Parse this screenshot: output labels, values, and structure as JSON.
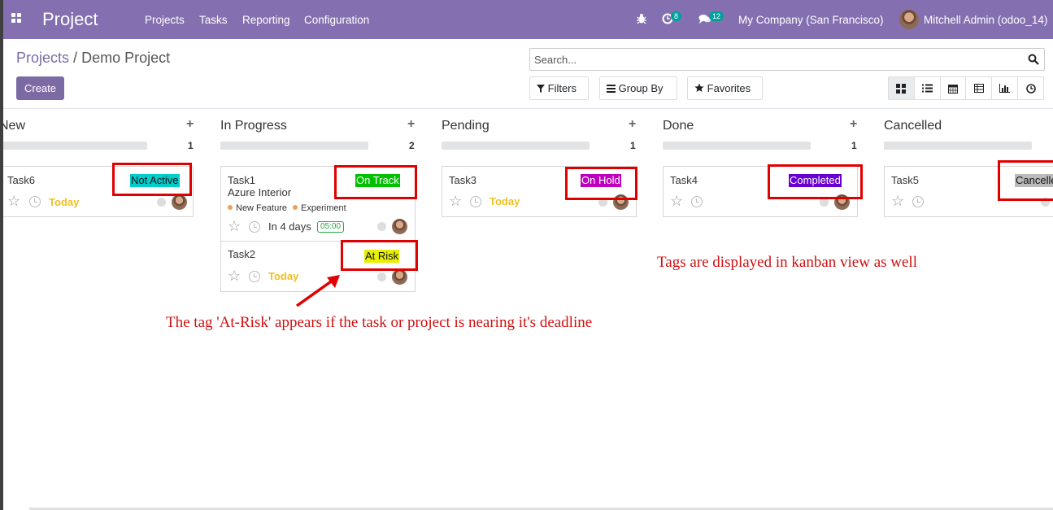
{
  "navbar": {
    "app_name": "Project",
    "menu": [
      "Projects",
      "Tasks",
      "Reporting",
      "Configuration"
    ],
    "activity_count": "8",
    "message_count": "12",
    "company": "My Company (San Francisco)",
    "user": "Mitchell Admin (odoo_14)",
    "bg_color": "#8470b0"
  },
  "control_panel": {
    "breadcrumb_parent": "Projects",
    "breadcrumb_sep": "/",
    "breadcrumb_current": "Demo Project",
    "create_label": "Create",
    "search_placeholder": "Search...",
    "filters_label": "Filters",
    "groupby_label": "Group By",
    "favorites_label": "Favorites",
    "views": [
      "kanban-icon",
      "list-icon",
      "calendar-icon",
      "pivot-icon",
      "graph-icon",
      "activity-icon"
    ]
  },
  "columns": [
    {
      "title": "New",
      "count": "1"
    },
    {
      "title": "In Progress",
      "count": "2"
    },
    {
      "title": "Pending",
      "count": "1"
    },
    {
      "title": "Done",
      "count": "1"
    },
    {
      "title": "Cancelled",
      "count": ""
    }
  ],
  "cards": {
    "task6": {
      "name": "Task6",
      "date": "Today",
      "tag": "Not Active",
      "tag_color": "#00cccc"
    },
    "task1": {
      "name": "Task1",
      "project": "Azure Interior",
      "tags": [
        "New Feature",
        "Experiment"
      ],
      "date": "In 4 days",
      "hours": "05:00",
      "tag": "On Track",
      "tag_color": "#00c000"
    },
    "task2": {
      "name": "Task2",
      "date": "Today",
      "tag": "At Risk",
      "tag_color": "#e6f000"
    },
    "task3": {
      "name": "Task3",
      "date": "Today",
      "tag": "On Hold",
      "tag_color": "#c000c0"
    },
    "task4": {
      "name": "Task4",
      "tag": "Completed",
      "tag_color": "#6a00d0"
    },
    "task5": {
      "name": "Task5",
      "tag": "Cancelled",
      "tag_color": "#bbbbbb"
    }
  },
  "annotations": {
    "at_risk_note": "The tag 'At-Risk' appears if the task or project is nearing it's deadline",
    "kanban_note": "Tags are displayed in kanban view as well"
  }
}
